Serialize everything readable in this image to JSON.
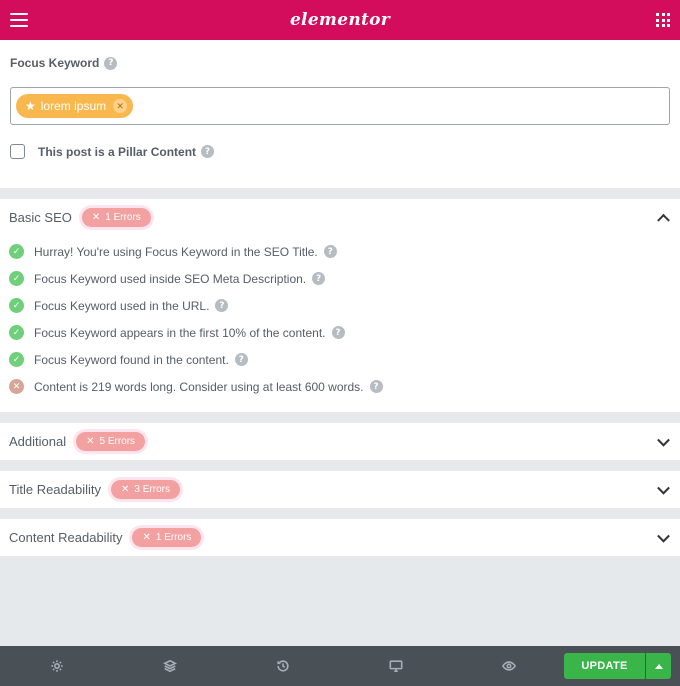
{
  "header": {
    "brand": "elementor"
  },
  "focus": {
    "label": "Focus Keyword",
    "keyword": "lorem ipsum",
    "pillar_label": "This post is a Pillar Content",
    "pillar_checked": false
  },
  "basic_seo": {
    "title": "Basic SEO",
    "badge": "1 Errors",
    "expanded": true,
    "checks": [
      {
        "text": "Hurray! You're using Focus Keyword in the SEO Title.",
        "status": "pass"
      },
      {
        "text": "Focus Keyword used inside SEO Meta Description.",
        "status": "pass"
      },
      {
        "text": "Focus Keyword used in the URL.",
        "status": "pass"
      },
      {
        "text": "Focus Keyword appears in the first 10% of the content.",
        "status": "pass"
      },
      {
        "text": "Focus Keyword found in the content.",
        "status": "pass"
      },
      {
        "text": "Content is 219 words long. Consider using at least 600 words.",
        "status": "fail"
      }
    ]
  },
  "sections": [
    {
      "title": "Additional",
      "badge": "5 Errors"
    },
    {
      "title": "Title Readability",
      "badge": "3 Errors"
    },
    {
      "title": "Content Readability",
      "badge": "1 Errors"
    }
  ],
  "footer": {
    "tools": [
      "gear-icon",
      "layers-icon",
      "history-icon",
      "desktop-icon",
      "eye-icon"
    ],
    "update_label": "UPDATE"
  },
  "colors": {
    "header": "#d30c5c",
    "keyword_tag": "#f8b84e",
    "error_badge": "#f3a0a0",
    "pass": "#6fcf7a",
    "fail": "#d8a599",
    "update": "#39b54a",
    "footer": "#495157"
  }
}
